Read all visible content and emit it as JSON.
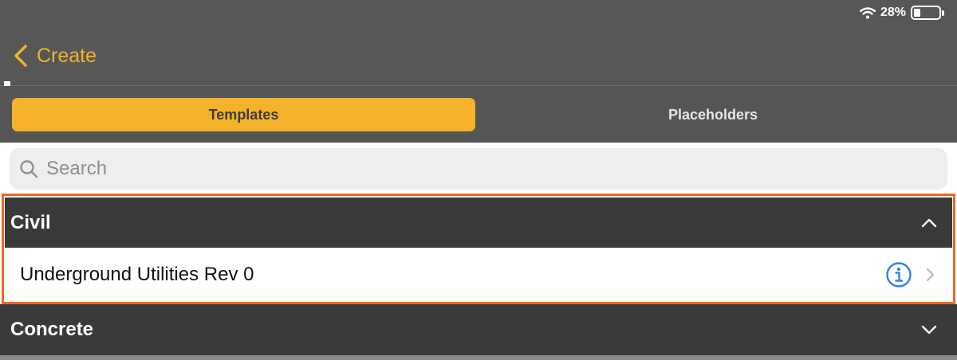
{
  "status_bar": {
    "battery_percent": "28%",
    "battery_level": 0.28,
    "icons": [
      "wifi-icon",
      "battery-icon"
    ]
  },
  "nav": {
    "back_label": "Create",
    "back_icon": "chevron-left-icon"
  },
  "segments": [
    {
      "label": "Templates",
      "selected": true
    },
    {
      "label": "Placeholders",
      "selected": false
    }
  ],
  "search": {
    "placeholder": "Search",
    "icon": "search-icon"
  },
  "sections": [
    {
      "title": "Civil",
      "expanded": true,
      "chevron": "chevron-up-icon",
      "items": [
        {
          "label": "Underground Utilities Rev 0",
          "info_icon": "info-icon",
          "disclosure_icon": "chevron-right-icon"
        }
      ]
    },
    {
      "title": "Concrete",
      "expanded": false,
      "chevron": "chevron-down-icon"
    }
  ],
  "colors": {
    "accent": "#F4B32A",
    "back_text": "#F0B22A",
    "highlight_border": "#F26722",
    "header_bg": "#3a3a3a",
    "nav_bg": "#575757",
    "info_blue": "#2F80ED"
  }
}
